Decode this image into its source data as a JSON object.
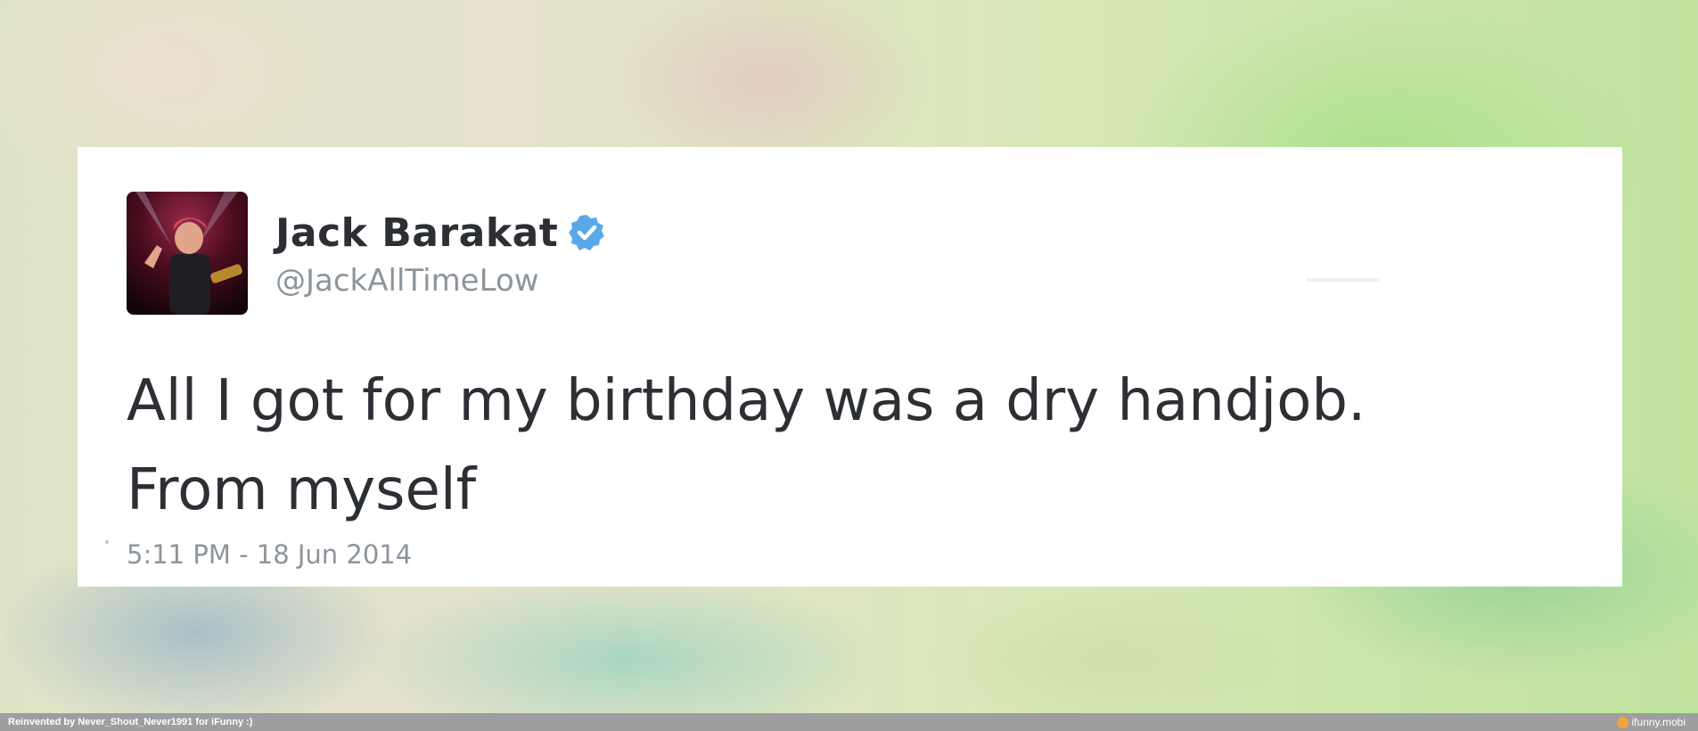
{
  "tweet": {
    "author_name": "Jack Barakat",
    "author_handle": "@JackAllTimeLow",
    "verified": true,
    "text_line1": "All I got for my birthday was a dry handjob.",
    "text_line2": "From myself",
    "timestamp": "5:11 PM - 18 Jun 2014"
  },
  "footer": {
    "credit": "Reinvented by Never_Shout_Never1991 for iFunny :)",
    "brand": "ifunny.mobi"
  },
  "icons": {
    "verified": "verified-badge-icon",
    "brand": "ifunny-logo-icon"
  },
  "colors": {
    "verified_blue": "#5ba8e8",
    "text": "#2c2f34",
    "muted": "#8d959c",
    "footer_bg": "#9c9e9f",
    "brand_orange": "#f4a23c"
  }
}
